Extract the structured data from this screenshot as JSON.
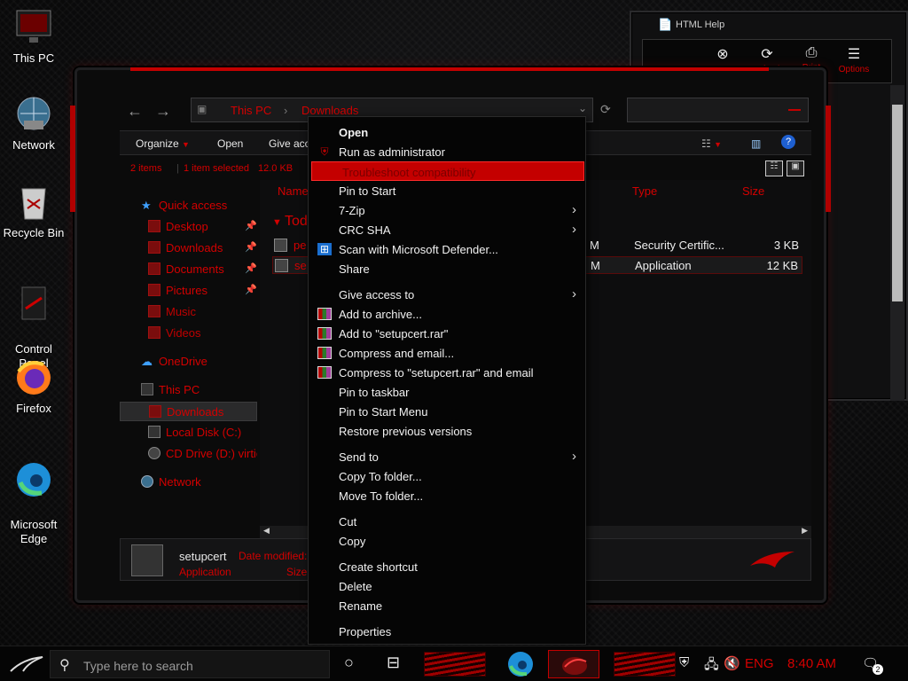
{
  "desktop": {
    "icons": [
      {
        "label": "This PC",
        "icon": "monitor-icon"
      },
      {
        "label": "Network",
        "icon": "globe-icon"
      },
      {
        "label": "Recycle Bin",
        "icon": "recycle-bin-icon"
      },
      {
        "label": "Control\nPanel",
        "icon": "control-panel-icon"
      },
      {
        "label": "Firefox",
        "icon": "firefox-icon"
      },
      {
        "label": "Microsoft\nEdge",
        "icon": "edge-icon"
      }
    ]
  },
  "help_window": {
    "title": "HTML Help",
    "buttons": [
      "Stop",
      "Refresh",
      "Print",
      "Options"
    ]
  },
  "explorer": {
    "path": [
      "This PC",
      "Downloads"
    ],
    "commands": [
      "Organize",
      "Open",
      "Give acce"
    ],
    "status": {
      "items": "2 items",
      "selected": "1 item selected",
      "size": "12.0 KB"
    },
    "nav": [
      {
        "label": "Quick access",
        "pinned": false
      },
      {
        "label": "Desktop",
        "pinned": true
      },
      {
        "label": "Downloads",
        "pinned": true
      },
      {
        "label": "Documents",
        "pinned": true
      },
      {
        "label": "Pictures",
        "pinned": true
      },
      {
        "label": "Music",
        "pinned": false
      },
      {
        "label": "Videos",
        "pinned": false
      },
      {
        "label": "OneDrive",
        "pinned": false
      },
      {
        "label": "This PC",
        "pinned": false
      },
      {
        "label": "Downloads",
        "pinned": false
      },
      {
        "label": "Local Disk (C:)",
        "pinned": false
      },
      {
        "label": "CD Drive (D:) virtic",
        "pinned": false
      },
      {
        "label": "Network",
        "pinned": false
      }
    ],
    "columns": {
      "name": "Name",
      "type": "Type",
      "size": "Size"
    },
    "group": "Tod",
    "files": [
      {
        "name": "pe",
        "date": "M",
        "type": "Security Certific...",
        "size": "3 KB"
      },
      {
        "name": "se",
        "date": "M",
        "type": "Application",
        "size": "12 KB"
      }
    ],
    "details": {
      "name": "setupcert",
      "type": "Application",
      "date_label": "Date modified:",
      "size_label": "Size:"
    }
  },
  "context_menu": {
    "items": [
      {
        "label": "Open",
        "bold": true
      },
      {
        "label": "Run as administrator",
        "icon": "shield-icon"
      },
      {
        "label": "Troubleshoot compatibility",
        "highlight": true
      },
      {
        "label": "Pin to Start"
      },
      {
        "label": "7-Zip",
        "submenu": true
      },
      {
        "label": "CRC SHA",
        "submenu": true
      },
      {
        "label": "Scan with Microsoft Defender...",
        "icon": "defender-icon"
      },
      {
        "label": "Share"
      },
      {
        "label": "Give access to",
        "submenu": true
      },
      {
        "label": "Add to archive...",
        "icon": "winrar-icon"
      },
      {
        "label": "Add to \"setupcert.rar\"",
        "icon": "winrar-icon"
      },
      {
        "label": "Compress and email...",
        "icon": "winrar-icon"
      },
      {
        "label": "Compress to \"setupcert.rar\" and email",
        "icon": "winrar-icon"
      },
      {
        "label": "Pin to taskbar"
      },
      {
        "label": "Pin to Start Menu"
      },
      {
        "label": "Restore previous versions"
      },
      {
        "label": "Send to",
        "submenu": true
      },
      {
        "label": "Copy To folder..."
      },
      {
        "label": "Move To folder..."
      },
      {
        "label": "Cut"
      },
      {
        "label": "Copy"
      },
      {
        "label": "Create shortcut"
      },
      {
        "label": "Delete"
      },
      {
        "label": "Rename"
      },
      {
        "label": "Properties"
      }
    ]
  },
  "taskbar": {
    "search_placeholder": "Type here to search",
    "language": "ENG",
    "time": "8:40 AM",
    "notifications": "2"
  }
}
